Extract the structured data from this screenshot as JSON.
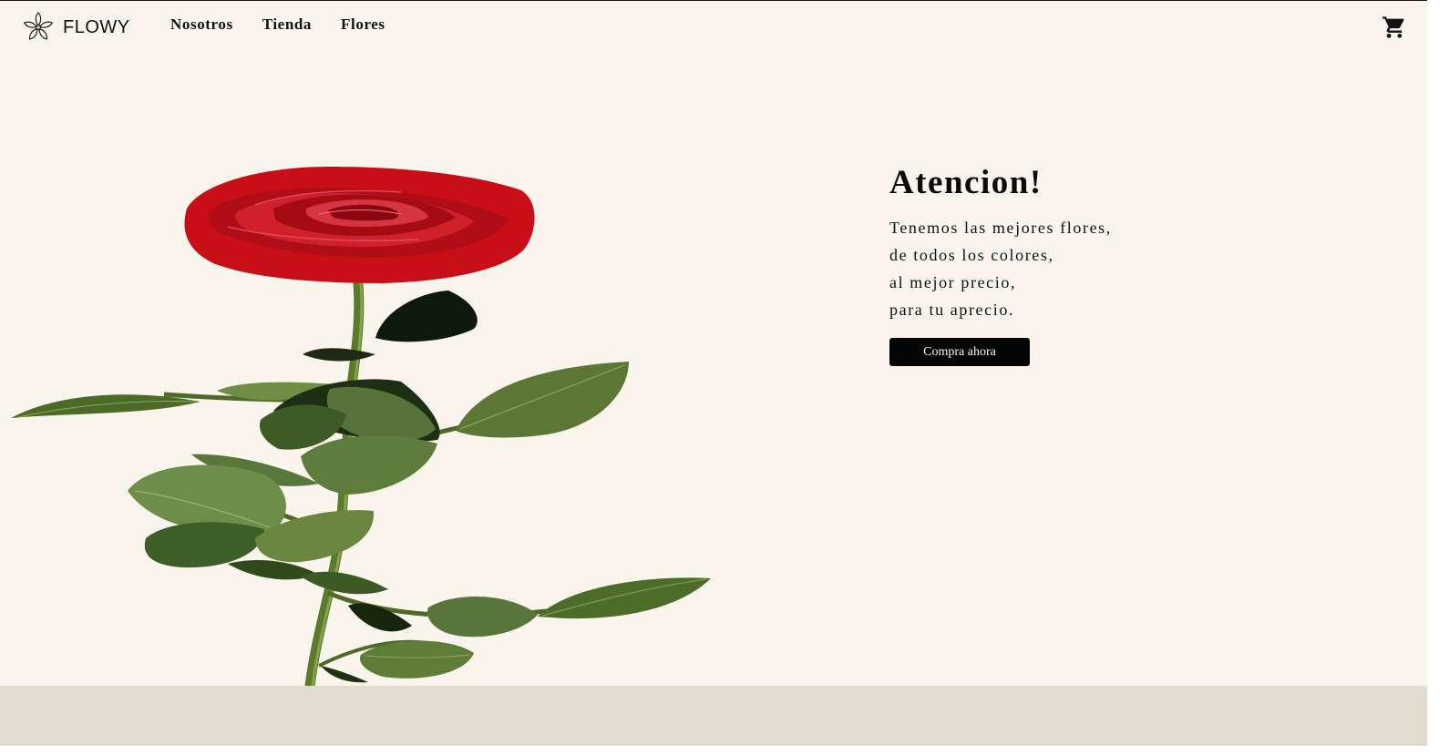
{
  "brand": {
    "name": "FLOWY",
    "icon": "flower-logo-icon"
  },
  "nav": {
    "items": [
      {
        "label": "Nosotros"
      },
      {
        "label": "Tienda"
      },
      {
        "label": "Flores"
      }
    ],
    "cart_icon": "shopping-cart-icon"
  },
  "hero": {
    "title": "Atencion!",
    "lines": [
      "Tenemos las mejores flores,",
      "de todos los colores,",
      "al mejor precio,",
      "para tu aprecio."
    ],
    "cta_label": "Compra ahora",
    "image": "red-rose-illustration"
  },
  "colors": {
    "background": "#f9f4ec",
    "footer_band": "#e4dbd1",
    "button": "#050505",
    "rose_red": "#c8101a",
    "leaf_green": "#55732f"
  }
}
